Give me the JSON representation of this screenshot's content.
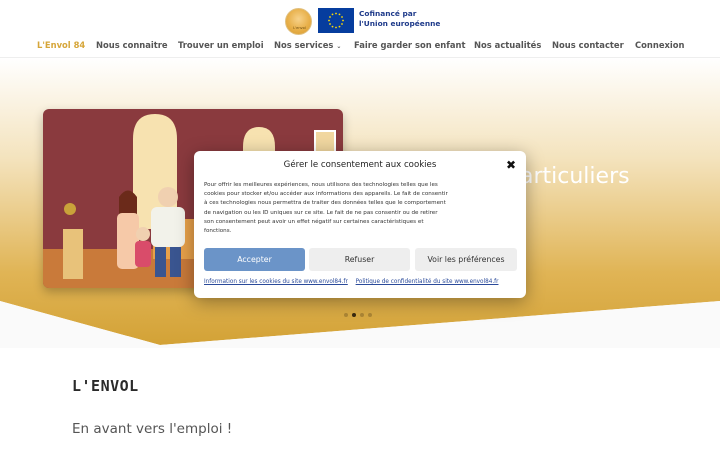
{
  "header": {
    "logo_text": "L'envol",
    "eu_line1": "Cofinancé par",
    "eu_line2": "l'Union européenne"
  },
  "nav": {
    "items": [
      {
        "label": "L'Envol 84",
        "active": true
      },
      {
        "label": "Nous connaitre"
      },
      {
        "label": "Trouver un emploi"
      },
      {
        "label": "Nos services"
      },
      {
        "label": "Faire garder son enfant"
      },
      {
        "label": "Nos actualités"
      },
      {
        "label": "Nous contacter"
      },
      {
        "label": "Connexion"
      }
    ]
  },
  "hero": {
    "heading_partial": "articuliers",
    "slides_total": 4,
    "slide_active": 2
  },
  "cookie_modal": {
    "title": "Gérer le consentement aux cookies",
    "body": "Pour offrir les meilleures expériences, nous utilisons des technologies telles que les cookies pour stocker et/ou accéder aux informations des appareils. Le fait de consentir à ces technologies nous permettra de traiter des données telles que le comportement de navigation ou les ID uniques sur ce site. Le fait de ne pas consentir ou de retirer son consentement peut avoir un effet négatif sur certaines caractéristiques et fonctions.",
    "accept_label": "Accepter",
    "refuse_label": "Refuser",
    "prefs_label": "Voir les préférences",
    "link_cookies": "Information sur les cookies du site www.envol84.fr",
    "link_privacy": "Politique de confidentialité du site www.envol84.fr"
  },
  "section": {
    "title": "L'ENVOL",
    "subtitle": "En avant vers l'emploi !"
  },
  "colors": {
    "accent_gold": "#d6a63a",
    "accept_blue": "#6b94c8",
    "eu_blue": "#063d9e",
    "eu_star": "#ffdd00"
  }
}
